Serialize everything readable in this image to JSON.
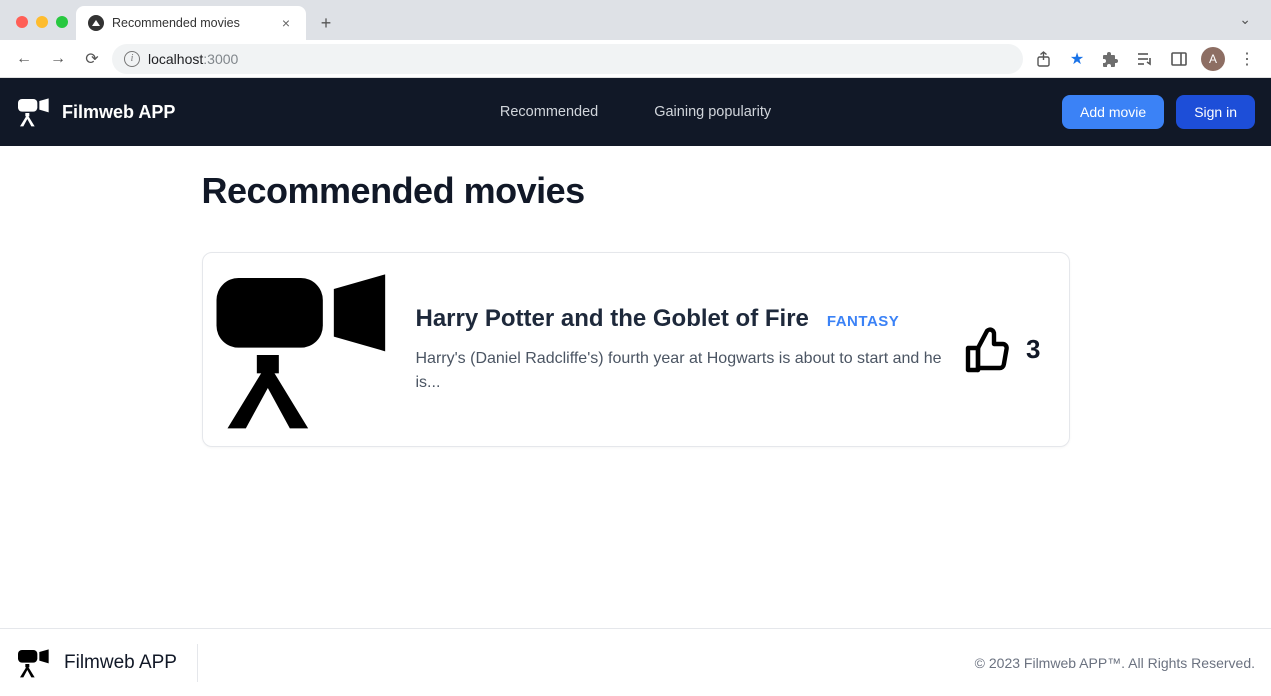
{
  "browser": {
    "tab_title": "Recommended movies",
    "url_host": "localhost",
    "url_port": ":3000",
    "avatar_initial": "A"
  },
  "header": {
    "brand": "Filmweb APP",
    "nav": {
      "recommended": "Recommended",
      "gaining": "Gaining popularity"
    },
    "add_movie": "Add movie",
    "sign_in": "Sign in"
  },
  "page": {
    "title": "Recommended movies"
  },
  "movies": [
    {
      "title": "Harry Potter and the Goblet of Fire",
      "genre": "FANTASY",
      "description": "Harry's (Daniel Radcliffe's) fourth year at Hogwarts is about to start and he is...",
      "likes": "3"
    }
  ],
  "footer": {
    "brand": "Filmweb APP",
    "copyright": "© 2023 Filmweb APP™. All Rights Reserved."
  }
}
